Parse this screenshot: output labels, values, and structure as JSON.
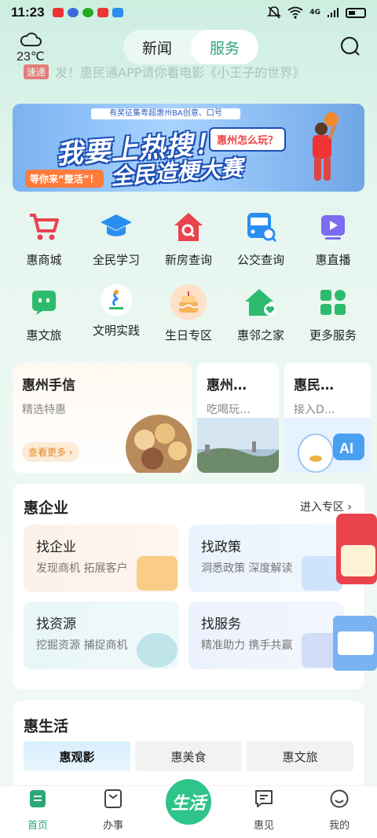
{
  "status": {
    "time": "11:23",
    "network": "4G"
  },
  "weather": {
    "temp": "23℃",
    "icon": "cloud-icon"
  },
  "top_tabs": [
    {
      "label": "新闻"
    },
    {
      "label": "服务"
    }
  ],
  "ticker": {
    "tag": "速递",
    "text": "发！惠民通APP请你看电影《小王子的世界》"
  },
  "banner": {
    "top_line": "有奖征集粤超惠州BA创意、口号",
    "bubble": "惠州怎么玩？",
    "title_line1": "我要上热搜！",
    "title_line2": "全民造梗大赛",
    "tag": "等你来“整活”！"
  },
  "grid_row1": [
    {
      "label": "惠商城",
      "icon": "cart-icon"
    },
    {
      "label": "全民学习",
      "icon": "graduation-cap-icon"
    },
    {
      "label": "新房查询",
      "icon": "house-search-icon"
    },
    {
      "label": "公交查询",
      "icon": "bus-search-icon"
    },
    {
      "label": "惠直播",
      "icon": "live-play-icon"
    }
  ],
  "grid_row2": [
    {
      "label": "惠文旅",
      "icon": "chat-bubble-icon"
    },
    {
      "label": "文明实践",
      "icon": "civilization-logo-icon"
    },
    {
      "label": "生日专区",
      "icon": "birthday-cake-icon"
    },
    {
      "label": "惠邻之家",
      "icon": "home-heart-icon"
    },
    {
      "label": "更多服务",
      "icon": "apps-grid-icon"
    }
  ],
  "feature_cards": [
    {
      "title": "惠州手信",
      "subtitle": "精选特惠",
      "more": "查看更多 ›"
    },
    {
      "title": "惠州…",
      "subtitle": "吃喝玩…"
    },
    {
      "title": "惠民…",
      "subtitle": "接入D…"
    }
  ],
  "enterprise": {
    "title": "惠企业",
    "zone_link": "进入专区 ›",
    "tiles": [
      {
        "title": "找企业",
        "subtitle": "发现商机 拓展客户"
      },
      {
        "title": "找政策",
        "subtitle": "洞悉政策 深度解读"
      },
      {
        "title": "找资源",
        "subtitle": "挖掘资源 捕捉商机"
      },
      {
        "title": "找服务",
        "subtitle": "精准助力 携手共赢"
      }
    ]
  },
  "life": {
    "title": "惠生活",
    "tabs": [
      {
        "label": "惠观影"
      },
      {
        "label": "惠美食"
      },
      {
        "label": "惠文旅"
      }
    ]
  },
  "tabbar": {
    "items": [
      {
        "label": "首页"
      },
      {
        "label": "办事"
      },
      {
        "label": "惠见"
      },
      {
        "label": "我的"
      }
    ],
    "center_label": "生活"
  },
  "colors": {
    "accent": "#2aa876",
    "center_button": "#2fc48a",
    "primary_red": "#e9434d"
  }
}
